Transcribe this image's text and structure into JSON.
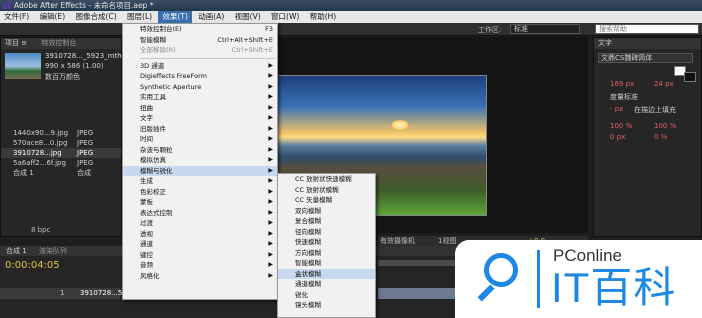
{
  "window": {
    "title": "Adobe After Effects - 未命名项目.aep *"
  },
  "menubar": {
    "items": [
      "文件(F)",
      "编辑(E)",
      "图像合成(C)",
      "图层(L)",
      "效果(T)",
      "动画(A)",
      "视图(V)",
      "窗口(W)",
      "帮助(H)"
    ],
    "active_index": 4
  },
  "toolbar": {
    "workspace_label": "工作区:",
    "workspace_value": "标准",
    "search_placeholder": "搜索帮助"
  },
  "project": {
    "tab1": "项目 ≡",
    "tab2": "特效控制台",
    "selected_name": "3910728..._5923_mthumb.jpg",
    "selected_info": "990 x 586 (1.00)",
    "selected_desc": "数百万颜色",
    "items": [
      {
        "name": "1440x90...9.jpg",
        "type": "JPEG"
      },
      {
        "name": "570ace8...0.jpg",
        "type": "JPEG"
      },
      {
        "name": "3910728...jpg",
        "type": "JPEG"
      },
      {
        "name": "5a6aff2...6f.jpg",
        "type": "JPEG"
      },
      {
        "name": "合成 1",
        "type": "合成"
      }
    ],
    "bpc": "8 bpc"
  },
  "right": {
    "tab": "文字",
    "font": "文鼎CS魏碑简体",
    "size1": "169 px",
    "size2": "24 px",
    "metrics": "度量标准",
    "px": "- px",
    "stroke": "在描边上填充",
    "pct1": "100 %",
    "pct2": "100 %",
    "px0": "0 px",
    "pct0": "0 %"
  },
  "timeline": {
    "tab1": "合成 1",
    "tab2": "渲染队列",
    "timecode": "0:00:04:05",
    "layer_num": "1",
    "layer_name": "3910728...54..."
  },
  "viewer_footer": {
    "camera": "有效摄像机",
    "view": "1视图",
    "value": "+0.0"
  },
  "effects_menu": {
    "items": [
      {
        "label": "特效控制台(E)",
        "shortcut": "F3"
      },
      {
        "label": "智能模糊",
        "shortcut": "Ctrl+Alt+Shift+E"
      },
      {
        "label": "全部移除(R)",
        "shortcut": "Ctrl+Shift+E",
        "disabled": true
      },
      {
        "sep": true
      },
      {
        "label": "3D 通道",
        "sub": true
      },
      {
        "label": "Digieffects FreeForm",
        "sub": true
      },
      {
        "label": "Synthetic Aperture",
        "sub": true
      },
      {
        "label": "实用工具",
        "sub": true
      },
      {
        "label": "扭曲",
        "sub": true
      },
      {
        "label": "文字",
        "sub": true
      },
      {
        "label": "旧版插件",
        "sub": true
      },
      {
        "label": "时间",
        "sub": true
      },
      {
        "label": "杂波与颗粒",
        "sub": true
      },
      {
        "label": "模拟仿真",
        "sub": true
      },
      {
        "label": "模糊与锐化",
        "sub": true,
        "highlight": true
      },
      {
        "label": "生成",
        "sub": true
      },
      {
        "label": "色彩校正",
        "sub": true
      },
      {
        "label": "蒙板",
        "sub": true
      },
      {
        "label": "表达式控制",
        "sub": true
      },
      {
        "label": "过渡",
        "sub": true
      },
      {
        "label": "透视",
        "sub": true
      },
      {
        "label": "通道",
        "sub": true
      },
      {
        "label": "键控",
        "sub": true
      },
      {
        "label": "音频",
        "sub": true
      },
      {
        "label": "风格化",
        "sub": true
      }
    ]
  },
  "blur_submenu": {
    "items": [
      {
        "label": "CC 放射状快速模糊"
      },
      {
        "label": "CC 放射状模糊"
      },
      {
        "label": "CC 矢量模糊"
      },
      {
        "label": "双向模糊"
      },
      {
        "label": "复合模糊"
      },
      {
        "label": "径向模糊"
      },
      {
        "label": "快速模糊"
      },
      {
        "label": "方向模糊"
      },
      {
        "label": "智能模糊"
      },
      {
        "label": "盒状模糊",
        "highlight": true
      },
      {
        "label": "通道模糊"
      },
      {
        "label": "锐化"
      },
      {
        "label": "镜头模糊"
      }
    ]
  },
  "watermark": {
    "brand": "PConline",
    "name": "IT百科"
  },
  "colors": {
    "accent": "#1e88e5",
    "menu_highlight": "#3a6fb0",
    "selection": "#c6d9ee"
  }
}
